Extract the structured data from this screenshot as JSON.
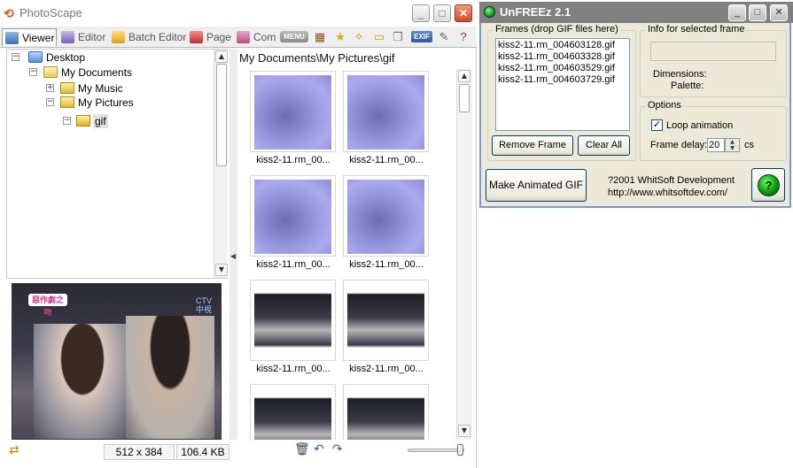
{
  "photoscape": {
    "title": "PhotoScape",
    "window_buttons": [
      "_",
      "□",
      "✕"
    ],
    "tabs": [
      {
        "label": "Viewer",
        "icon": "viewer-icon",
        "active": true
      },
      {
        "label": "Editor",
        "icon": "editor-icon"
      },
      {
        "label": "Batch Editor",
        "icon": "batch-editor-icon"
      },
      {
        "label": "Page",
        "icon": "page-icon"
      },
      {
        "label": "Com",
        "icon": "combine-icon"
      }
    ],
    "toolbar": {
      "menu_label": "MENU",
      "exif_label": "EXIF"
    },
    "tree": [
      {
        "label": "Desktop",
        "expander": "−",
        "icon": "desktop-icon"
      },
      {
        "label": "My Documents",
        "expander": "−",
        "icon": "my-documents-icon"
      },
      {
        "label": "My Music",
        "expander": "+",
        "icon": "folder-icon"
      },
      {
        "label": "My Pictures",
        "expander": "−",
        "icon": "folder-icon"
      },
      {
        "label": "gif",
        "expander": "−",
        "icon": "folder-open-icon",
        "selected": true
      }
    ],
    "preview": {
      "logo_text": "惡作劇之吻",
      "channel_text": "CTV 中視"
    },
    "status": {
      "dimensions": "512 x 384",
      "file_size": "106.4 KB"
    },
    "path": "My Documents\\My Pictures\\gif",
    "thumbnails": [
      {
        "caption": "kiss2-11.rm_00...",
        "style": "purple"
      },
      {
        "caption": "kiss2-11.rm_00...",
        "style": "purple"
      },
      {
        "caption": "kiss2-11.rm_00...",
        "style": "purple"
      },
      {
        "caption": "kiss2-11.rm_00...",
        "style": "purple"
      },
      {
        "caption": "kiss2-11.rm_00...",
        "style": "dark"
      },
      {
        "caption": "kiss2-11.rm_00...",
        "style": "dark"
      },
      {
        "caption": "",
        "style": "dark"
      },
      {
        "caption": "",
        "style": "dark"
      }
    ],
    "zoom_level": 0.95
  },
  "unfreez": {
    "title": "UnFREEz 2.1",
    "window_buttons": [
      "_",
      "□",
      "✕"
    ],
    "frames_group": "Frames (drop GIF files here)",
    "frames": [
      "kiss2-11.rm_004603128.gif",
      "kiss2-11.rm_004603328.gif",
      "kiss2-11.rm_004603529.gif",
      "kiss2-11.rm_004603729.gif"
    ],
    "remove_frame": "Remove Frame",
    "clear_all": "Clear All",
    "info_group": "Info for selected frame",
    "dimensions_label": "Dimensions:",
    "palette_label": "Palette:",
    "options_group": "Options",
    "loop_label": "Loop animation",
    "loop_checked": true,
    "frame_delay_label": "Frame delay:",
    "frame_delay_value": "20",
    "frame_delay_unit": "cs",
    "make_button": "Make Animated GIF",
    "copyright": "?2001 WhitSoft Development",
    "url": "http://www.whitsoftdev.com/",
    "help_symbol": "?"
  },
  "colors": {
    "xp_face": "#ece9d8",
    "xp_border": "#7a96df",
    "tab_bg": "#efefef",
    "close_red": "#d8472a",
    "help_green": "#0d9a0d"
  }
}
